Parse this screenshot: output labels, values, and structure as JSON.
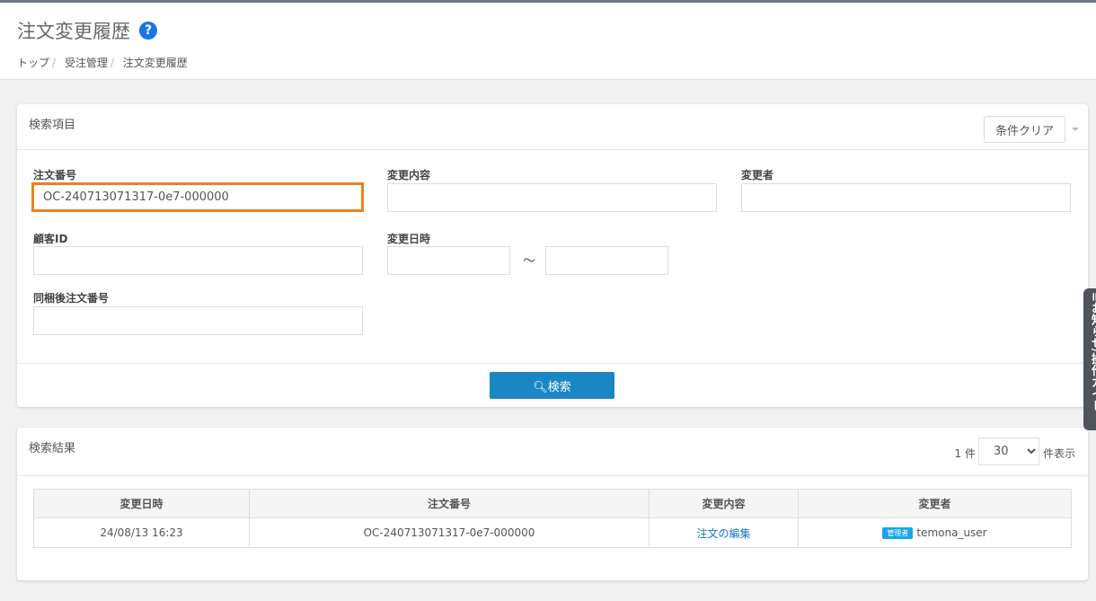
{
  "header": {
    "title": "注文変更履歴",
    "breadcrumb": [
      "トップ",
      "受注管理",
      "注文変更履歴"
    ]
  },
  "search": {
    "title": "検索項目",
    "clear_label": "条件クリア",
    "order_no_label": "注文番号",
    "order_no_value": "OC-240713071317-0e7-000000",
    "change_content_label": "変更内容",
    "changer_label": "変更者",
    "customer_id_label": "顧客ID",
    "change_date_label": "変更日時",
    "tilde": "～",
    "bundled_label": "同梱後注文番号",
    "search_label": "検索"
  },
  "results": {
    "title": "検索結果",
    "count": "1 件",
    "per_page": "30",
    "per_page_suffix": "件表示",
    "columns": [
      "変更日時",
      "注文番号",
      "変更内容",
      "変更者"
    ],
    "rows": [
      {
        "date": "24/08/13 16:23",
        "order": "OC-240713071317-0e7-000000",
        "content": "注文の編集",
        "badge": "管理者",
        "user": "temona_user"
      }
    ]
  },
  "side_tab": {
    "label": "お知らせ/操作ガイド"
  },
  "colors": {
    "accent": "#1a87c4",
    "highlight": "#f07f22"
  }
}
